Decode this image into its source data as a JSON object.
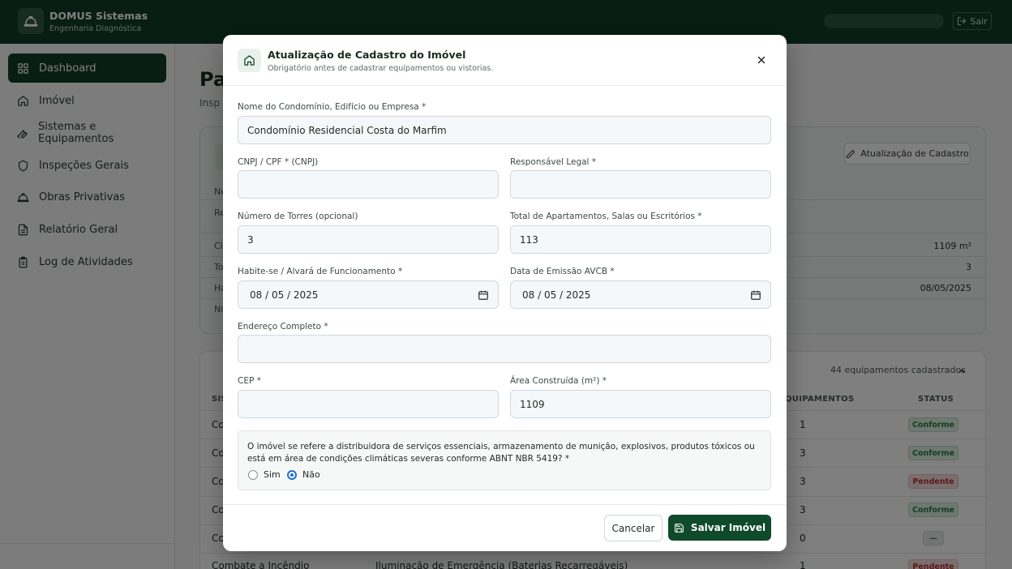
{
  "header": {
    "brand_name": "DOMUS Sistemas",
    "brand_sub": "Engenharia Diagnóstica",
    "logout_label": "Sair"
  },
  "sidebar": {
    "items": [
      {
        "label": "Dashboard",
        "icon": "grid-icon",
        "active": true
      },
      {
        "label": "Imóvel",
        "icon": "home-icon"
      },
      {
        "label": "Sistemas e Equipamentos",
        "icon": "wrench-icon"
      },
      {
        "label": "Inspeções Gerais",
        "icon": "shield-icon"
      },
      {
        "label": "Obras Privativas",
        "icon": "hardhat-icon"
      },
      {
        "label": "Relatório Geral",
        "icon": "file-icon"
      },
      {
        "label": "Log de Atividades",
        "icon": "clipboard-icon"
      }
    ]
  },
  "page": {
    "title_partial": "Pa",
    "sub_partial": "Insp",
    "update_button": "Atualização de Cadastro",
    "info_rows": [
      {
        "label": "Ne",
        "value": ""
      },
      {
        "label": "Re",
        "value": ""
      },
      {
        "label": "Cl",
        "value": "1109 m²"
      },
      {
        "label": "To",
        "value": "3"
      },
      {
        "label": "Ha",
        "value": "08/05/2025"
      },
      {
        "label": "Ni",
        "value": ""
      }
    ],
    "equip_count": "44 equipamentos cadastrados",
    "table": {
      "headers": [
        "SIS",
        "QUIPAMENTOS",
        "STATUS"
      ],
      "rows": [
        {
          "system": "Co",
          "count": "1",
          "status": "Conforme"
        },
        {
          "system": "Co",
          "count": "3",
          "status": "Conforme"
        },
        {
          "system": "Co",
          "count": "3",
          "status": "Pendente"
        },
        {
          "system": "Co",
          "count": "3",
          "status": "Conforme"
        },
        {
          "system": "Co",
          "count": "0",
          "status": "—"
        },
        {
          "system": "Combate a Incêndio",
          "equipment": "Iluminação de Emergência (Baterias Recarregáveis)",
          "count": "1",
          "status": "Pendente"
        }
      ]
    }
  },
  "modal": {
    "title": "Atualização de Cadastro do Imóvel",
    "subtitle": "Obrigatório antes de cadastrar equipamentos ou vistorias.",
    "fields": {
      "name": {
        "label": "Nome do Condomínio, Edifício ou Empresa *",
        "value": "Condomínio Residencial Costa do Marfim"
      },
      "cnpj": {
        "label": "CNPJ / CPF * (CNPJ)",
        "value": ""
      },
      "legal": {
        "label": "Responsável Legal *",
        "value": ""
      },
      "towers": {
        "label": "Número de Torres (opcional)",
        "value": "3"
      },
      "units": {
        "label": "Total de Apartamentos, Salas ou Escritórios *",
        "value": "113"
      },
      "habitese": {
        "label": "Habite-se / Alvará de Funcionamento *",
        "value": "08 / 05 / 2025"
      },
      "avcb": {
        "label": "Data de Emissão AVCB *",
        "value": "08 / 05 / 2025"
      },
      "address": {
        "label": "Endereço Completo *",
        "value": ""
      },
      "cep": {
        "label": "CEP *",
        "value": ""
      },
      "area": {
        "label": "Área Construída (m²) *",
        "value": "1109"
      }
    },
    "hazard": {
      "question": "O imóvel se refere a distribuidora de serviços essenciais, armazenamento de munição, explosivos, produtos tóxicos ou está em área de condições climáticas severas conforme ABNT NBR 5419? *",
      "option_yes": "Sim",
      "option_no": "Não",
      "selected": "Não"
    },
    "cancel_label": "Cancelar",
    "save_label": "Salvar Imóvel"
  },
  "colors": {
    "brand": "#103d25",
    "primary_button": "#0f4a2a",
    "radio_accent": "#1e6fd0",
    "status_ok": "#2a7a45",
    "status_pending": "#b23434"
  }
}
